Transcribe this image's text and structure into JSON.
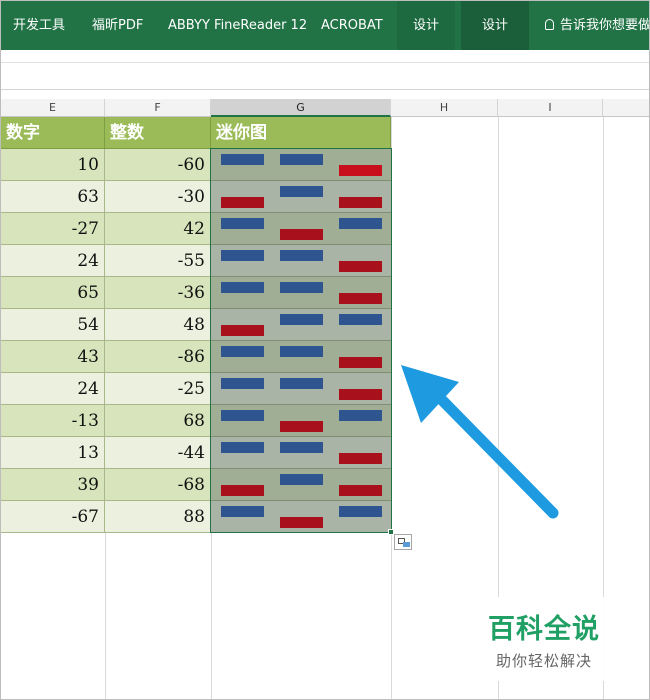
{
  "ribbon": {
    "tabs": [
      {
        "label": "开发工具"
      },
      {
        "label": "福昕PDF"
      },
      {
        "label": "ABBYY FineReader 12"
      },
      {
        "label": "ACROBAT"
      },
      {
        "label": "设计"
      },
      {
        "label": "设计"
      }
    ],
    "tell_me": "告诉我你想要做",
    "tell_me_icon": "lightbulb-icon"
  },
  "columns": [
    "E",
    "F",
    "G",
    "H",
    "I"
  ],
  "selected_column": "G",
  "table": {
    "headers": [
      "数字",
      "整数",
      "迷你图"
    ],
    "rows": [
      {
        "e": "10",
        "f": "-60"
      },
      {
        "e": "63",
        "f": "-30"
      },
      {
        "e": "-27",
        "f": "42"
      },
      {
        "e": "24",
        "f": "-55"
      },
      {
        "e": "65",
        "f": "-36"
      },
      {
        "e": "54",
        "f": "48"
      },
      {
        "e": "43",
        "f": "-86"
      },
      {
        "e": "24",
        "f": "-25"
      },
      {
        "e": "-13",
        "f": "68"
      },
      {
        "e": "13",
        "f": "-44"
      },
      {
        "e": "39",
        "f": "-68"
      },
      {
        "e": "-67",
        "f": "88"
      }
    ]
  },
  "sparklines": {
    "positive_color": "#2f5590",
    "negative_color": "#a8101c",
    "highlight_negative_color": "#c8101c",
    "rows": [
      [
        1,
        1,
        -1
      ],
      [
        -1,
        1,
        -1
      ],
      [
        1,
        -1,
        1
      ],
      [
        1,
        1,
        -1
      ],
      [
        1,
        1,
        -1
      ],
      [
        -1,
        1,
        1
      ],
      [
        1,
        1,
        -1
      ],
      [
        1,
        1,
        -1
      ],
      [
        1,
        -1,
        1
      ],
      [
        1,
        1,
        -1
      ],
      [
        -1,
        1,
        -1
      ],
      [
        1,
        -1,
        1
      ]
    ]
  },
  "arrow_color": "#1e9be0",
  "watermark": {
    "title": "百科全说",
    "subtitle": "助你轻松解决"
  }
}
